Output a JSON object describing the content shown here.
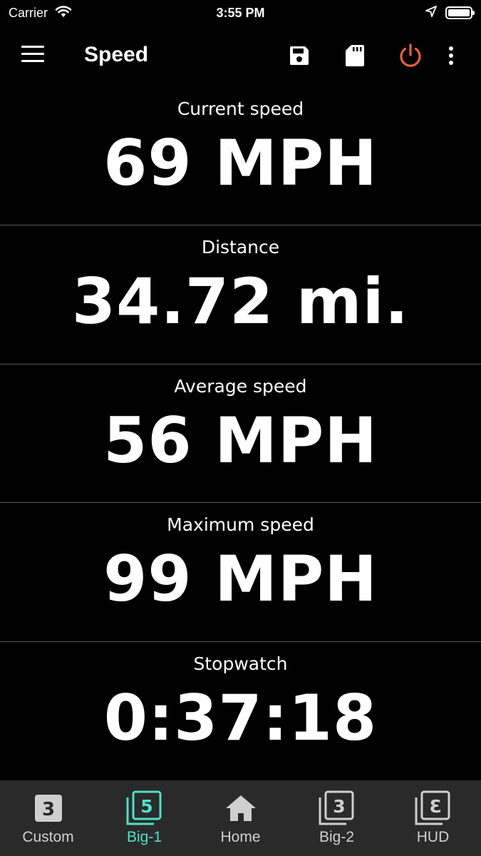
{
  "status_bar": {
    "carrier": "Carrier",
    "time": "3:55 PM"
  },
  "app_bar": {
    "title": "Speed",
    "icons": [
      "menu-icon",
      "save-icon",
      "sd-card-icon",
      "power-icon",
      "more-vert-icon"
    ],
    "power_color": "#e8623a"
  },
  "panels": [
    {
      "label": "Current speed",
      "value": "69 MPH"
    },
    {
      "label": "Distance",
      "value": "34.72 mi."
    },
    {
      "label": "Average speed",
      "value": "56 MPH"
    },
    {
      "label": "Maximum speed",
      "value": "99 MPH"
    },
    {
      "label": "Stopwatch",
      "value": "0:37:18"
    }
  ],
  "tabs": [
    {
      "label": "Custom",
      "icon": "custom-3-icon",
      "active": false
    },
    {
      "label": "Big-1",
      "icon": "big-1-5-icon",
      "active": true
    },
    {
      "label": "Home",
      "icon": "home-icon",
      "active": false
    },
    {
      "label": "Big-2",
      "icon": "big-2-3-icon",
      "active": false
    },
    {
      "label": "HUD",
      "icon": "hud-icon",
      "active": false
    }
  ],
  "colors": {
    "background": "#000000",
    "tab_bar": "#2a2a2a",
    "accent": "#4fe0c8",
    "divider": "#5a5a5a"
  }
}
